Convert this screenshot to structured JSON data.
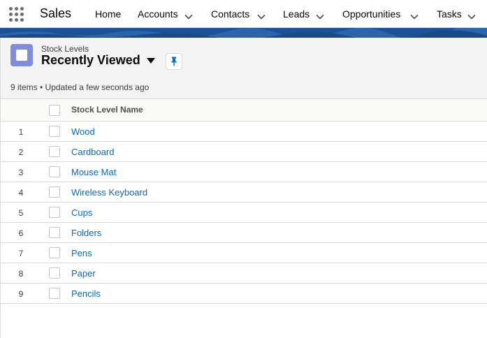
{
  "app": {
    "name": "Sales",
    "launcher_icon": "app-launcher-grid-icon"
  },
  "nav": [
    {
      "label": "Home",
      "has_menu": false
    },
    {
      "label": "Accounts",
      "has_menu": true
    },
    {
      "label": "Contacts",
      "has_menu": true
    },
    {
      "label": "Leads",
      "has_menu": true
    },
    {
      "label": "Opportunities",
      "has_menu": true
    },
    {
      "label": "Tasks",
      "has_menu": true
    }
  ],
  "header": {
    "object_label": "Stock Levels",
    "list_view_name": "Recently Viewed",
    "object_icon": "custom-object-icon",
    "pin_icon": "pin-icon",
    "meta": "9 items • Updated a few seconds ago"
  },
  "table": {
    "column_header": "Stock Level Name",
    "rows": [
      {
        "num": "1",
        "name": "Wood"
      },
      {
        "num": "2",
        "name": "Cardboard"
      },
      {
        "num": "3",
        "name": "Mouse Mat"
      },
      {
        "num": "4",
        "name": "Wireless Keyboard"
      },
      {
        "num": "5",
        "name": "Cups"
      },
      {
        "num": "6",
        "name": "Folders"
      },
      {
        "num": "7",
        "name": "Pens"
      },
      {
        "num": "8",
        "name": "Paper"
      },
      {
        "num": "9",
        "name": "Pencils"
      }
    ]
  },
  "colors": {
    "brand_band": "#1b5297",
    "object_icon": "#7f8de1",
    "link": "#006dcc",
    "pin": "#0070d2"
  }
}
